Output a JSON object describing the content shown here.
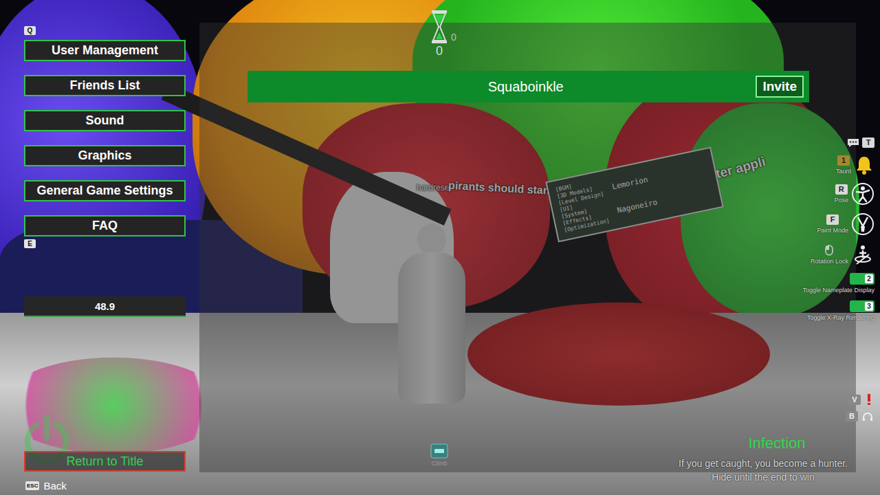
{
  "scene": {
    "nameplate": "hardreset",
    "sign_text": "pirants should stand here",
    "banner_text": "Hunter appli",
    "credits_board": {
      "roles": [
        "[BGM]",
        "[3D Models]",
        "[Level Design]",
        "[UI]",
        "[System]",
        "[Effects]",
        "[Optimization]"
      ],
      "names": [
        "Lemorion",
        "Nagoneiro"
      ]
    }
  },
  "menu": {
    "top_key": "Q",
    "bottom_key": "E",
    "items": [
      {
        "label": "User Management",
        "selected": false
      },
      {
        "label": "Friends List",
        "selected": false
      },
      {
        "label": "Sound",
        "selected": false
      },
      {
        "label": "Graphics",
        "selected": false
      },
      {
        "label": "General Game Settings",
        "selected": false
      },
      {
        "label": "FAQ",
        "selected": false
      }
    ]
  },
  "readout": "48.9",
  "return_button": "Return to Title",
  "back": {
    "key": "ESC",
    "label": "Back"
  },
  "timer": {
    "count": "0",
    "round": "0"
  },
  "players": [
    {
      "name": "Squaboinkle",
      "action": "Invite"
    }
  ],
  "hud": [
    {
      "kind": "chat",
      "key": "T",
      "label": ""
    },
    {
      "kind": "action",
      "key": "1",
      "label": "Taunt"
    },
    {
      "kind": "action",
      "key": "R",
      "label": "Pose"
    },
    {
      "kind": "action",
      "key": "F",
      "label": "Paint Mode"
    },
    {
      "kind": "mouse",
      "key": "",
      "label": "Rotation Lock"
    },
    {
      "kind": "toggle",
      "key": "2",
      "label": "Toggle Nameplate Display",
      "on": true
    },
    {
      "kind": "toggle",
      "key": "3",
      "label": "Toggle X-Ray Rendering",
      "on": true
    }
  ],
  "voice": [
    {
      "key": "V"
    },
    {
      "key": "B"
    }
  ],
  "prompt": {
    "label": "Climb"
  },
  "mode": {
    "title": "Infection",
    "lines": [
      "If you get caught, you become a hunter.",
      "Hide until the end to win"
    ]
  }
}
